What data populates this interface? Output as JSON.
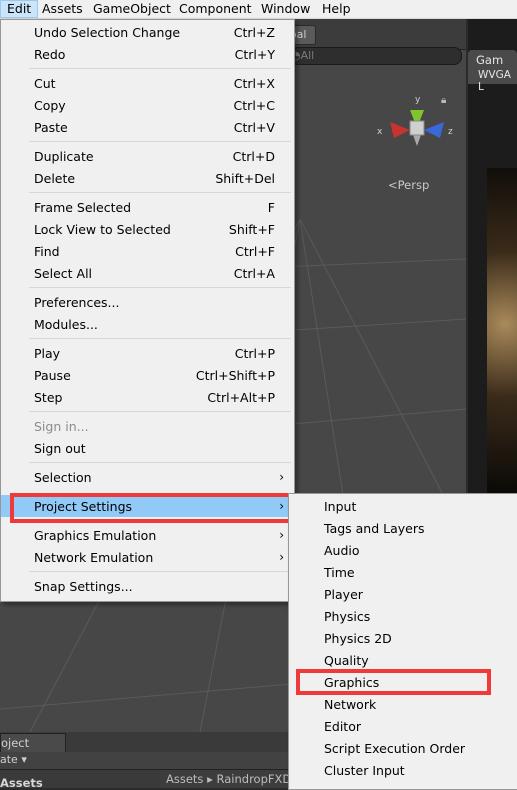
{
  "menubar": {
    "items": [
      "Edit",
      "Assets",
      "GameObject",
      "Component",
      "Window",
      "Help"
    ]
  },
  "background": {
    "global_label": "bal",
    "search_placeholder": "◔All",
    "gizmo": {
      "y": "y",
      "x": "x",
      "z": "z"
    },
    "persp_label": "<Persp",
    "game_tab_label": "Gam",
    "game_resolution": "WVGA L",
    "project_tab_label": "oject",
    "create_label": "ate ▾",
    "assets_label": "Assets",
    "breadcrumb": "Assets ▸ RaindropFXD"
  },
  "edit_menu": {
    "items": [
      {
        "label": "Undo Selection Change",
        "shortcut": "Ctrl+Z"
      },
      {
        "label": "Redo",
        "shortcut": "Ctrl+Y"
      },
      {
        "label": "Cut",
        "shortcut": "Ctrl+X"
      },
      {
        "label": "Copy",
        "shortcut": "Ctrl+C"
      },
      {
        "label": "Paste",
        "shortcut": "Ctrl+V"
      },
      {
        "label": "Duplicate",
        "shortcut": "Ctrl+D"
      },
      {
        "label": "Delete",
        "shortcut": "Shift+Del"
      },
      {
        "label": "Frame Selected",
        "shortcut": "F"
      },
      {
        "label": "Lock View to Selected",
        "shortcut": "Shift+F"
      },
      {
        "label": "Find",
        "shortcut": "Ctrl+F"
      },
      {
        "label": "Select All",
        "shortcut": "Ctrl+A"
      },
      {
        "label": "Preferences...",
        "shortcut": ""
      },
      {
        "label": "Modules...",
        "shortcut": ""
      },
      {
        "label": "Play",
        "shortcut": "Ctrl+P"
      },
      {
        "label": "Pause",
        "shortcut": "Ctrl+Shift+P"
      },
      {
        "label": "Step",
        "shortcut": "Ctrl+Alt+P"
      },
      {
        "label": "Sign in...",
        "shortcut": ""
      },
      {
        "label": "Sign out",
        "shortcut": ""
      },
      {
        "label": "Selection",
        "shortcut": ""
      },
      {
        "label": "Project Settings",
        "shortcut": ""
      },
      {
        "label": "Graphics Emulation",
        "shortcut": ""
      },
      {
        "label": "Network Emulation",
        "shortcut": ""
      },
      {
        "label": "Snap Settings...",
        "shortcut": ""
      }
    ]
  },
  "project_settings_submenu": {
    "items": [
      "Input",
      "Tags and Layers",
      "Audio",
      "Time",
      "Player",
      "Physics",
      "Physics 2D",
      "Quality",
      "Graphics",
      "Network",
      "Editor",
      "Script Execution Order",
      "Cluster Input"
    ]
  },
  "colors": {
    "highlight": "#91c9f7",
    "annotation_red": "#f03a3a",
    "gizmo_y": "#7ec62b",
    "gizmo_x": "#c8342d",
    "gizmo_z": "#3968d8"
  }
}
